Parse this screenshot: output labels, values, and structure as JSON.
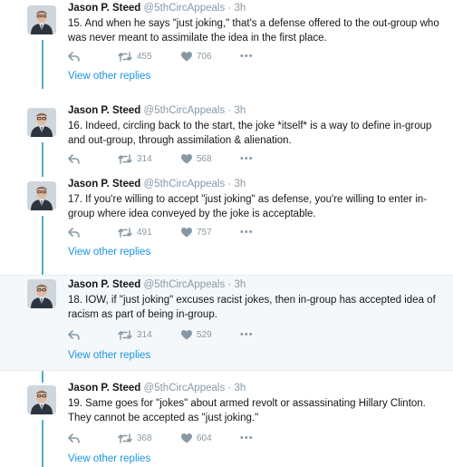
{
  "tweets": [
    {
      "name": "Jason P. Steed",
      "handle": "@5thCircAppeals",
      "time": "3h",
      "text": "15. And when he says \"just joking,\" that's a defense offered to the out-group who was never meant to assimilate the idea in the first place.",
      "retweets": "455",
      "likes": "706",
      "view_replies": "View other replies"
    },
    {
      "name": "Jason P. Steed",
      "handle": "@5thCircAppeals",
      "time": "3h",
      "text": "16. Indeed, circling back to the start, the joke *itself* is a way to define in-group and out-group, through assimilation & alienation.",
      "retweets": "314",
      "likes": "568",
      "view_replies": ""
    },
    {
      "name": "Jason P. Steed",
      "handle": "@5thCircAppeals",
      "time": "3h",
      "text": "17. If you're willing to accept \"just joking\" as defense, you're willing to enter in-group where idea conveyed by the joke is acceptable.",
      "retweets": "491",
      "likes": "757",
      "view_replies": "View other replies"
    },
    {
      "name": "Jason P. Steed",
      "handle": "@5thCircAppeals",
      "time": "3h",
      "text": "18. IOW, if \"just joking\" excuses racist jokes, then in-group has accepted idea of racism as part of being in-group.",
      "retweets": "314",
      "likes": "529",
      "view_replies": "View other replies"
    },
    {
      "name": "Jason P. Steed",
      "handle": "@5thCircAppeals",
      "time": "3h",
      "text": "19. Same goes for \"jokes\" about armed revolt or assassinating Hillary Clinton. They cannot be accepted as \"just joking.\"",
      "retweets": "368",
      "likes": "604",
      "view_replies": "View other replies"
    }
  ],
  "more_glyph": "•••",
  "icons": {
    "reply": "reply-icon",
    "retweet": "retweet-icon",
    "like": "heart-icon",
    "more": "more-icon"
  },
  "colors": {
    "thread_line": "#4ab3c0",
    "link": "#1b95e0",
    "muted": "#8899a6",
    "highlight_bg": "#f5f8fa"
  }
}
